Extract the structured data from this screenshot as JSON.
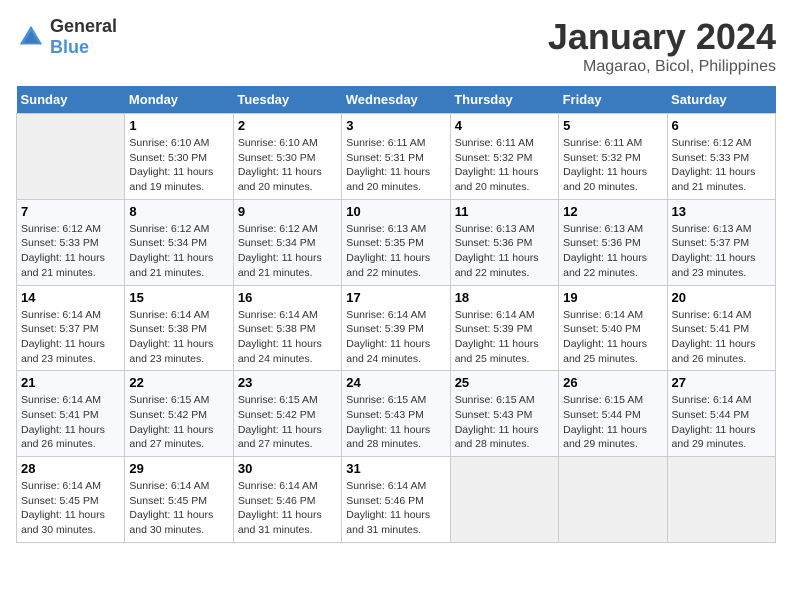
{
  "header": {
    "logo_general": "General",
    "logo_blue": "Blue",
    "month_year": "January 2024",
    "location": "Magarao, Bicol, Philippines"
  },
  "days_of_week": [
    "Sunday",
    "Monday",
    "Tuesday",
    "Wednesday",
    "Thursday",
    "Friday",
    "Saturday"
  ],
  "weeks": [
    [
      {
        "day": "",
        "empty": true
      },
      {
        "day": "1",
        "sunrise": "Sunrise: 6:10 AM",
        "sunset": "Sunset: 5:30 PM",
        "daylight": "Daylight: 11 hours and 19 minutes."
      },
      {
        "day": "2",
        "sunrise": "Sunrise: 6:10 AM",
        "sunset": "Sunset: 5:30 PM",
        "daylight": "Daylight: 11 hours and 20 minutes."
      },
      {
        "day": "3",
        "sunrise": "Sunrise: 6:11 AM",
        "sunset": "Sunset: 5:31 PM",
        "daylight": "Daylight: 11 hours and 20 minutes."
      },
      {
        "day": "4",
        "sunrise": "Sunrise: 6:11 AM",
        "sunset": "Sunset: 5:32 PM",
        "daylight": "Daylight: 11 hours and 20 minutes."
      },
      {
        "day": "5",
        "sunrise": "Sunrise: 6:11 AM",
        "sunset": "Sunset: 5:32 PM",
        "daylight": "Daylight: 11 hours and 20 minutes."
      },
      {
        "day": "6",
        "sunrise": "Sunrise: 6:12 AM",
        "sunset": "Sunset: 5:33 PM",
        "daylight": "Daylight: 11 hours and 21 minutes."
      }
    ],
    [
      {
        "day": "7",
        "sunrise": "Sunrise: 6:12 AM",
        "sunset": "Sunset: 5:33 PM",
        "daylight": "Daylight: 11 hours and 21 minutes."
      },
      {
        "day": "8",
        "sunrise": "Sunrise: 6:12 AM",
        "sunset": "Sunset: 5:34 PM",
        "daylight": "Daylight: 11 hours and 21 minutes."
      },
      {
        "day": "9",
        "sunrise": "Sunrise: 6:12 AM",
        "sunset": "Sunset: 5:34 PM",
        "daylight": "Daylight: 11 hours and 21 minutes."
      },
      {
        "day": "10",
        "sunrise": "Sunrise: 6:13 AM",
        "sunset": "Sunset: 5:35 PM",
        "daylight": "Daylight: 11 hours and 22 minutes."
      },
      {
        "day": "11",
        "sunrise": "Sunrise: 6:13 AM",
        "sunset": "Sunset: 5:36 PM",
        "daylight": "Daylight: 11 hours and 22 minutes."
      },
      {
        "day": "12",
        "sunrise": "Sunrise: 6:13 AM",
        "sunset": "Sunset: 5:36 PM",
        "daylight": "Daylight: 11 hours and 22 minutes."
      },
      {
        "day": "13",
        "sunrise": "Sunrise: 6:13 AM",
        "sunset": "Sunset: 5:37 PM",
        "daylight": "Daylight: 11 hours and 23 minutes."
      }
    ],
    [
      {
        "day": "14",
        "sunrise": "Sunrise: 6:14 AM",
        "sunset": "Sunset: 5:37 PM",
        "daylight": "Daylight: 11 hours and 23 minutes."
      },
      {
        "day": "15",
        "sunrise": "Sunrise: 6:14 AM",
        "sunset": "Sunset: 5:38 PM",
        "daylight": "Daylight: 11 hours and 23 minutes."
      },
      {
        "day": "16",
        "sunrise": "Sunrise: 6:14 AM",
        "sunset": "Sunset: 5:38 PM",
        "daylight": "Daylight: 11 hours and 24 minutes."
      },
      {
        "day": "17",
        "sunrise": "Sunrise: 6:14 AM",
        "sunset": "Sunset: 5:39 PM",
        "daylight": "Daylight: 11 hours and 24 minutes."
      },
      {
        "day": "18",
        "sunrise": "Sunrise: 6:14 AM",
        "sunset": "Sunset: 5:39 PM",
        "daylight": "Daylight: 11 hours and 25 minutes."
      },
      {
        "day": "19",
        "sunrise": "Sunrise: 6:14 AM",
        "sunset": "Sunset: 5:40 PM",
        "daylight": "Daylight: 11 hours and 25 minutes."
      },
      {
        "day": "20",
        "sunrise": "Sunrise: 6:14 AM",
        "sunset": "Sunset: 5:41 PM",
        "daylight": "Daylight: 11 hours and 26 minutes."
      }
    ],
    [
      {
        "day": "21",
        "sunrise": "Sunrise: 6:14 AM",
        "sunset": "Sunset: 5:41 PM",
        "daylight": "Daylight: 11 hours and 26 minutes."
      },
      {
        "day": "22",
        "sunrise": "Sunrise: 6:15 AM",
        "sunset": "Sunset: 5:42 PM",
        "daylight": "Daylight: 11 hours and 27 minutes."
      },
      {
        "day": "23",
        "sunrise": "Sunrise: 6:15 AM",
        "sunset": "Sunset: 5:42 PM",
        "daylight": "Daylight: 11 hours and 27 minutes."
      },
      {
        "day": "24",
        "sunrise": "Sunrise: 6:15 AM",
        "sunset": "Sunset: 5:43 PM",
        "daylight": "Daylight: 11 hours and 28 minutes."
      },
      {
        "day": "25",
        "sunrise": "Sunrise: 6:15 AM",
        "sunset": "Sunset: 5:43 PM",
        "daylight": "Daylight: 11 hours and 28 minutes."
      },
      {
        "day": "26",
        "sunrise": "Sunrise: 6:15 AM",
        "sunset": "Sunset: 5:44 PM",
        "daylight": "Daylight: 11 hours and 29 minutes."
      },
      {
        "day": "27",
        "sunrise": "Sunrise: 6:14 AM",
        "sunset": "Sunset: 5:44 PM",
        "daylight": "Daylight: 11 hours and 29 minutes."
      }
    ],
    [
      {
        "day": "28",
        "sunrise": "Sunrise: 6:14 AM",
        "sunset": "Sunset: 5:45 PM",
        "daylight": "Daylight: 11 hours and 30 minutes."
      },
      {
        "day": "29",
        "sunrise": "Sunrise: 6:14 AM",
        "sunset": "Sunset: 5:45 PM",
        "daylight": "Daylight: 11 hours and 30 minutes."
      },
      {
        "day": "30",
        "sunrise": "Sunrise: 6:14 AM",
        "sunset": "Sunset: 5:46 PM",
        "daylight": "Daylight: 11 hours and 31 minutes."
      },
      {
        "day": "31",
        "sunrise": "Sunrise: 6:14 AM",
        "sunset": "Sunset: 5:46 PM",
        "daylight": "Daylight: 11 hours and 31 minutes."
      },
      {
        "day": "",
        "empty": true
      },
      {
        "day": "",
        "empty": true
      },
      {
        "day": "",
        "empty": true
      }
    ]
  ]
}
